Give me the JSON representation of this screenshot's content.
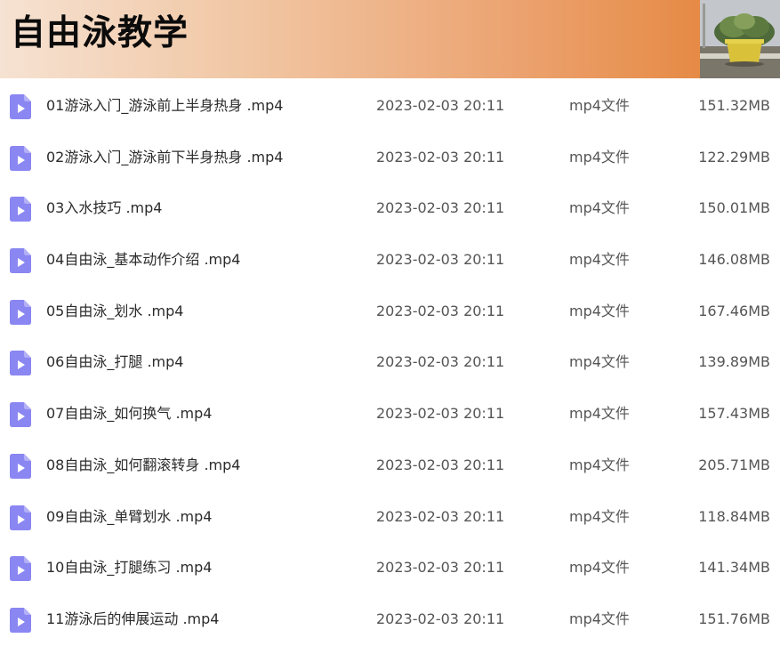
{
  "header": {
    "title": "自由泳教学"
  },
  "files": [
    {
      "name": "01游泳入门_游泳前上半身热身 .mp4",
      "date": "2023-02-03 20:11",
      "type": "mp4文件",
      "size": "151.32MB"
    },
    {
      "name": "02游泳入门_游泳前下半身热身 .mp4",
      "date": "2023-02-03 20:11",
      "type": "mp4文件",
      "size": "122.29MB"
    },
    {
      "name": "03入水技巧 .mp4",
      "date": "2023-02-03 20:11",
      "type": "mp4文件",
      "size": "150.01MB"
    },
    {
      "name": "04自由泳_基本动作介绍 .mp4",
      "date": "2023-02-03 20:11",
      "type": "mp4文件",
      "size": "146.08MB"
    },
    {
      "name": "05自由泳_划水 .mp4",
      "date": "2023-02-03 20:11",
      "type": "mp4文件",
      "size": "167.46MB"
    },
    {
      "name": "06自由泳_打腿 .mp4",
      "date": "2023-02-03 20:11",
      "type": "mp4文件",
      "size": "139.89MB"
    },
    {
      "name": "07自由泳_如何换气 .mp4",
      "date": "2023-02-03 20:11",
      "type": "mp4文件",
      "size": "157.43MB"
    },
    {
      "name": "08自由泳_如何翻滚转身 .mp4",
      "date": "2023-02-03 20:11",
      "type": "mp4文件",
      "size": "205.71MB"
    },
    {
      "name": "09自由泳_单臂划水 .mp4",
      "date": "2023-02-03 20:11",
      "type": "mp4文件",
      "size": "118.84MB"
    },
    {
      "name": "10自由泳_打腿练习 .mp4",
      "date": "2023-02-03 20:11",
      "type": "mp4文件",
      "size": "141.34MB"
    },
    {
      "name": "11游泳后的伸展运动 .mp4",
      "date": "2023-02-03 20:11",
      "type": "mp4文件",
      "size": "151.76MB"
    }
  ],
  "icons": {
    "file": "video-file-icon",
    "photo": "potted-plant-photo"
  },
  "colors": {
    "icon_fill": "#8a86f2",
    "banner_end": "#e48940"
  }
}
